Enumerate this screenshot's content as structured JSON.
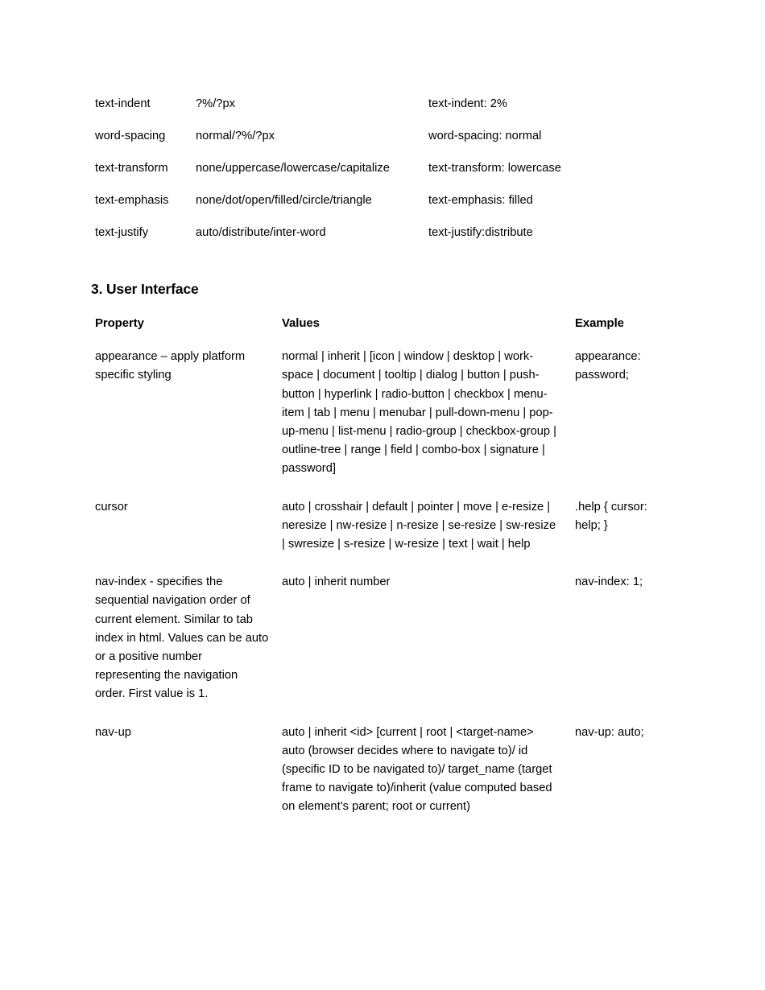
{
  "document": {
    "text_properties_table": {
      "rows": [
        {
          "property": "text-indent",
          "values": "?%/?px",
          "example": "text-indent: 2%"
        },
        {
          "property": "word-spacing",
          "values": "normal/?%/?px",
          "example": "word-spacing: normal"
        },
        {
          "property": "text-transform",
          "values": "none/uppercase/lowercase/capitalize",
          "example": "text-transform: lowercase"
        },
        {
          "property": "text-emphasis",
          "values": "none/dot/open/filled/circle/triangle",
          "example": "text-emphasis: filled"
        },
        {
          "property": "text-justify",
          "values": "auto/distribute/inter-word",
          "example": "text-justify:distribute"
        }
      ]
    },
    "section": {
      "heading": "3. User Interface"
    },
    "ui_table": {
      "headers": {
        "property": "Property",
        "values": "Values",
        "example": "Example"
      },
      "rows": [
        {
          "property": "appearance – apply platform specific styling",
          "values": "normal | inherit | [icon | window | desktop | work-space | document | tooltip | dialog | button | push-button | hyperlink | radio-button | checkbox | menu-item | tab | menu | menubar | pull-down-menu | pop-up-menu | list-menu | radio-group | checkbox-group | outline-tree | range | field | combo-box | signature | password]",
          "example": "appearance: password;"
        },
        {
          "property": "cursor",
          "values": "auto | crosshair | default | pointer | move | e-resize | neresize | nw-resize | n-resize | se-resize | sw-resize | swresize | s-resize | w-resize | text | wait | help",
          "example": ".help { cursor: help; }"
        },
        {
          "property": "nav-index - specifies the sequential navigation order of current element. Similar to tab index in html. Values can be auto or a positive number representing the navigation order. First value is 1.",
          "values": "auto | inherit  number",
          "example": "nav-index: 1;"
        },
        {
          "property": "nav-up",
          "values": "auto | inherit <id> [current | root | <target-name> auto (browser decides where to navigate to)/ id (specific ID to be navigated to)/ target_name (target frame to navigate to)/inherit (value computed based on element’s parent; root or current)",
          "example": "nav-up: auto;"
        }
      ]
    }
  }
}
